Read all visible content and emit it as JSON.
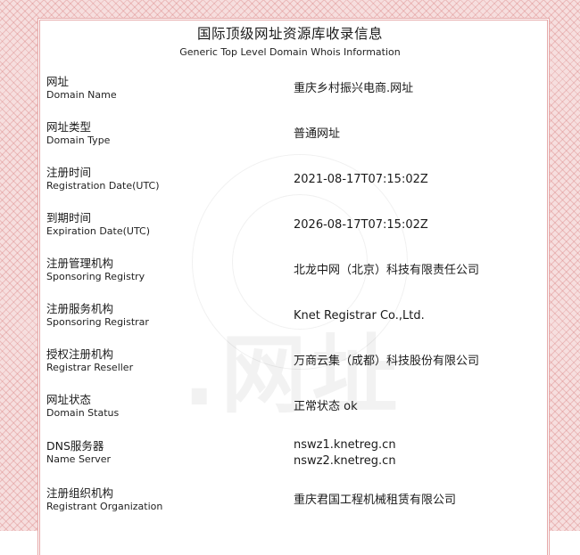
{
  "title": "国际顶级网址资源库收录信息",
  "subtitle": "Generic Top Level Domain Whois Information",
  "watermark": ".网址",
  "rows": [
    {
      "label_cn": "网址",
      "label_en": "Domain Name",
      "value": "重庆乡村振兴电商.网址"
    },
    {
      "label_cn": "网址类型",
      "label_en": "Domain Type",
      "value": "普通网址"
    },
    {
      "label_cn": "注册时间",
      "label_en": "Registration Date(UTC)",
      "value": "2021-08-17T07:15:02Z"
    },
    {
      "label_cn": "到期时间",
      "label_en": "Expiration Date(UTC)",
      "value": "2026-08-17T07:15:02Z"
    },
    {
      "label_cn": "注册管理机构",
      "label_en": "Sponsoring Registry",
      "value": "北龙中网（北京）科技有限责任公司"
    },
    {
      "label_cn": "注册服务机构",
      "label_en": "Sponsoring Registrar",
      "value": "Knet Registrar Co.,Ltd."
    },
    {
      "label_cn": "授权注册机构",
      "label_en": "Registrar Reseller",
      "value": "万商云集（成都）科技股份有限公司"
    },
    {
      "label_cn": "网址状态",
      "label_en": "Domain Status",
      "value": "正常状态 ok"
    },
    {
      "label_cn": "DNS服务器",
      "label_en": "Name Server",
      "value": "nswz1.knetreg.cn",
      "value2": "nswz2.knetreg.cn"
    },
    {
      "label_cn": "注册组织机构",
      "label_en": "Registrant Organization",
      "value": "重庆君国工程机械租赁有限公司"
    }
  ]
}
